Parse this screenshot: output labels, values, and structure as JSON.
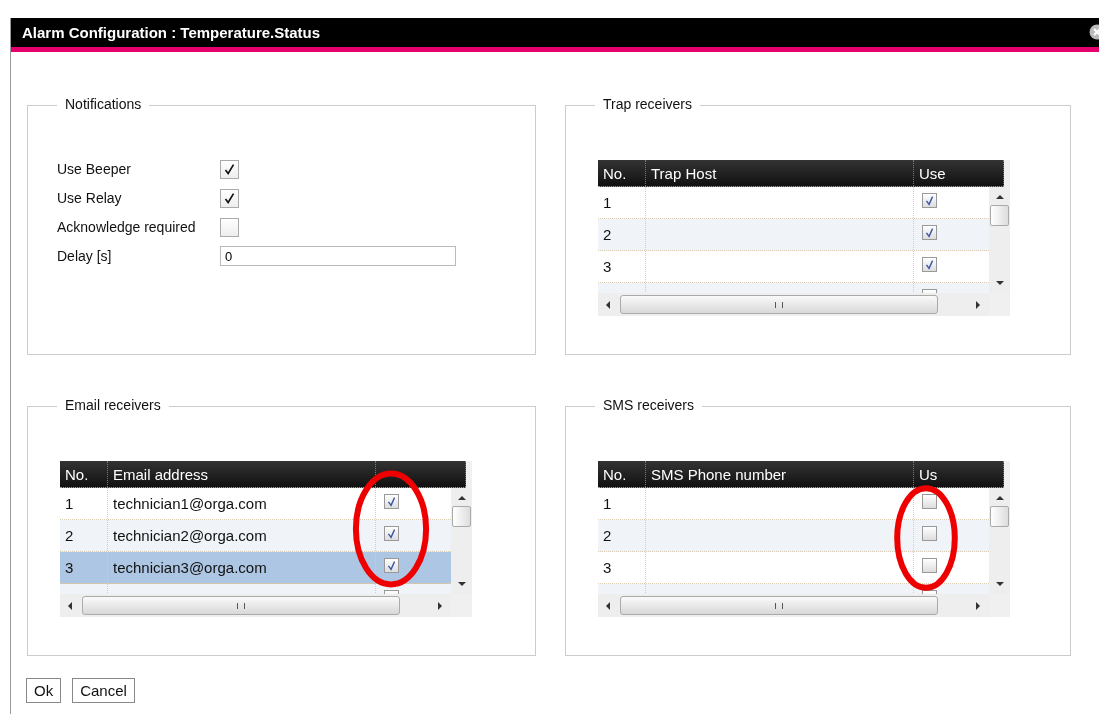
{
  "window": {
    "title": "Alarm Configuration : Temperature.Status"
  },
  "notifications": {
    "legend": "Notifications",
    "items": [
      {
        "kind": "checkbox",
        "label": "Use Beeper",
        "checked": true
      },
      {
        "kind": "checkbox",
        "label": "Use Relay",
        "checked": true
      },
      {
        "kind": "checkbox",
        "label": "Acknowledge required",
        "checked": false
      },
      {
        "kind": "text",
        "label": "Delay [s]",
        "value": "0"
      }
    ]
  },
  "tables": [
    {
      "legend": "Trap receivers",
      "columns": [
        "No.",
        "Trap Host",
        "Use"
      ],
      "highlight": false,
      "rows": [
        {
          "no": "1",
          "value": "",
          "use": true,
          "selected": false
        },
        {
          "no": "2",
          "value": "",
          "use": true,
          "selected": false
        },
        {
          "no": "3",
          "value": "",
          "use": true,
          "selected": false
        },
        {
          "selected": false
        }
      ]
    },
    {
      "legend": "Email receivers",
      "columns": [
        "No.",
        "Email address"
      ],
      "highlight": true,
      "rows": [
        {
          "no": "1",
          "value": "technician1@orga.com",
          "use": true,
          "selected": false
        },
        {
          "no": "2",
          "value": "technician2@orga.com",
          "use": true,
          "selected": false
        },
        {
          "no": "3",
          "value": "technician3@orga.com",
          "use": true,
          "selected": true
        },
        {
          "selected": false
        }
      ]
    },
    {
      "legend": "SMS receivers",
      "columns": [
        "No.",
        "SMS Phone number",
        "Us"
      ],
      "highlight": true,
      "rows": [
        {
          "no": "1",
          "value": "",
          "use": false,
          "selected": false
        },
        {
          "no": "2",
          "value": "",
          "use": false,
          "selected": false
        },
        {
          "no": "3",
          "value": "",
          "use": false,
          "selected": false
        },
        {
          "selected": false
        }
      ]
    }
  ],
  "buttons": [
    "Ok",
    "Cancel"
  ]
}
